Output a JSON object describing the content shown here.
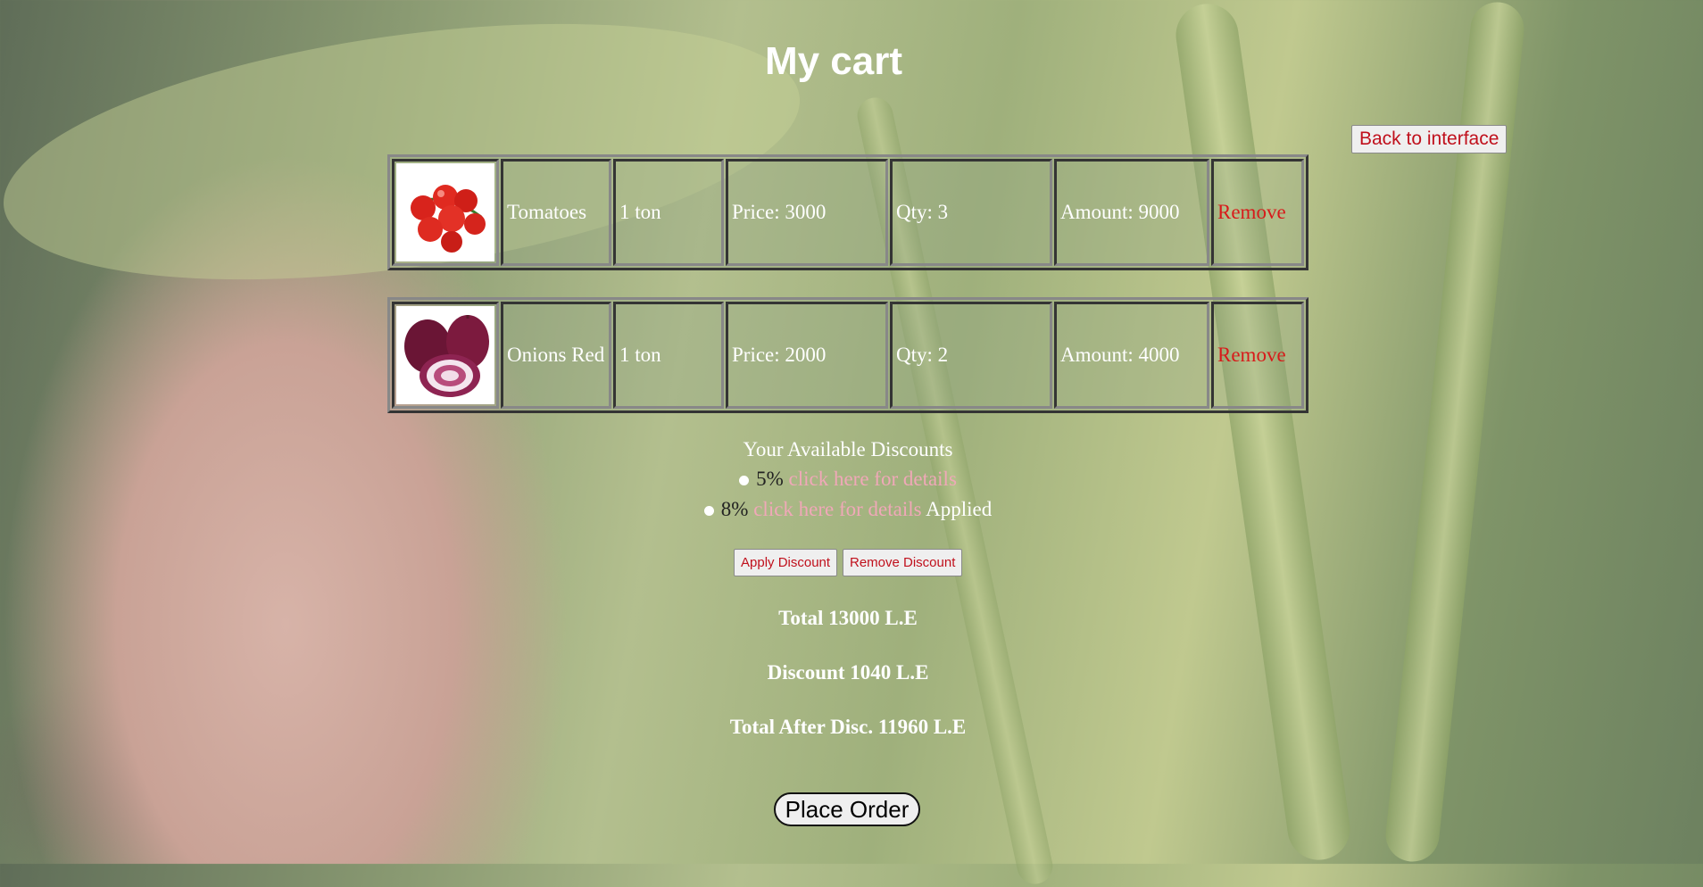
{
  "page": {
    "title": "My cart",
    "back_label": "Back to interface"
  },
  "cart": [
    {
      "image_icon": "tomatoes-image",
      "name": "Tomatoes",
      "unit": "1 ton",
      "price": "Price: 3000",
      "qty": "Qty: 3",
      "amount": "Amount: 9000",
      "remove_label": "Remove"
    },
    {
      "image_icon": "red-onions-image",
      "name": "Onions Red",
      "unit": "1 ton",
      "price": "Price: 2000",
      "qty": "Qty: 2",
      "amount": "Amount: 4000",
      "remove_label": "Remove"
    }
  ],
  "discounts": {
    "heading": "Your Available Discounts",
    "items": [
      {
        "percent": "5%",
        "link": "click here for details",
        "status": ""
      },
      {
        "percent": "8%",
        "link": "click here for details",
        "status": "Applied"
      }
    ],
    "apply_label": "Apply Discount",
    "remove_label": "Remove Discount"
  },
  "totals": {
    "total": "Total 13000 L.E",
    "discount": "Discount 1040 L.E",
    "after": "Total After Disc. 11960 L.E"
  },
  "order_label": "Place Order"
}
